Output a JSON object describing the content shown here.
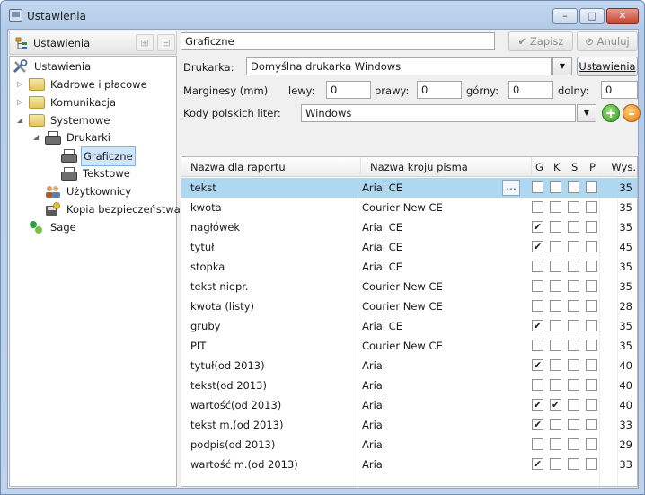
{
  "window": {
    "title": "Ustawienia",
    "minimize": "–",
    "maximize": "□",
    "close": "✕"
  },
  "left_toolbar": {
    "label": "Ustawienia"
  },
  "tree": {
    "root": "Ustawienia",
    "kadrowe": "Kadrowe i płacowe",
    "komunikacja": "Komunikacja",
    "systemowe": "Systemowe",
    "drukarki": "Drukarki",
    "graficzne": "Graficzne",
    "tekstowe": "Tekstowe",
    "uzytkownicy": "Użytkownicy",
    "kopia": "Kopia bezpieczeństwa",
    "sage": "Sage"
  },
  "form": {
    "name_value": "Graficzne",
    "save_label": "Zapisz",
    "cancel_label": "Anuluj",
    "printer_label": "Drukarka:",
    "printer_value": "Domyślna drukarka Windows",
    "printer_settings_label": "Ustawienia",
    "margins_label": "Marginesy (mm)",
    "left_label": "lewy:",
    "left_value": "0",
    "right_label": "prawy:",
    "right_value": "0",
    "top_label": "górny:",
    "top_value": "0",
    "bottom_label": "dolny:",
    "bottom_value": "0",
    "codes_label": "Kody polskich liter:",
    "codes_value": "Windows",
    "add_symbol": "+",
    "remove_symbol": "–"
  },
  "grid": {
    "headers": {
      "name": "Nazwa dla raportu",
      "font": "Nazwa kroju pisma",
      "g": "G",
      "k": "K",
      "s": "S",
      "p": "P",
      "height": "Wys."
    },
    "ellipsis": "...",
    "rows": [
      {
        "name": "tekst",
        "font": "Arial CE",
        "g": false,
        "k": false,
        "s": false,
        "p": false,
        "height": "35"
      },
      {
        "name": "kwota",
        "font": "Courier New CE",
        "g": false,
        "k": false,
        "s": false,
        "p": false,
        "height": "35"
      },
      {
        "name": "nagłówek",
        "font": "Arial CE",
        "g": true,
        "k": false,
        "s": false,
        "p": false,
        "height": "35"
      },
      {
        "name": "tytuł",
        "font": "Arial CE",
        "g": true,
        "k": false,
        "s": false,
        "p": false,
        "height": "45"
      },
      {
        "name": "stopka",
        "font": "Arial CE",
        "g": false,
        "k": false,
        "s": false,
        "p": false,
        "height": "35"
      },
      {
        "name": "tekst niepr.",
        "font": "Courier New CE",
        "g": false,
        "k": false,
        "s": false,
        "p": false,
        "height": "35"
      },
      {
        "name": "kwota (listy)",
        "font": "Courier New CE",
        "g": false,
        "k": false,
        "s": false,
        "p": false,
        "height": "28"
      },
      {
        "name": "gruby",
        "font": "Arial CE",
        "g": true,
        "k": false,
        "s": false,
        "p": false,
        "height": "35"
      },
      {
        "name": "PIT",
        "font": "Courier New CE",
        "g": false,
        "k": false,
        "s": false,
        "p": false,
        "height": "35"
      },
      {
        "name": "tytuł(od 2013)",
        "font": "Arial",
        "g": true,
        "k": false,
        "s": false,
        "p": false,
        "height": "40"
      },
      {
        "name": "tekst(od 2013)",
        "font": "Arial",
        "g": false,
        "k": false,
        "s": false,
        "p": false,
        "height": "40"
      },
      {
        "name": "wartość(od 2013)",
        "font": "Arial",
        "g": true,
        "k": true,
        "s": false,
        "p": false,
        "height": "40"
      },
      {
        "name": "tekst m.(od 2013)",
        "font": "Arial",
        "g": true,
        "k": false,
        "s": false,
        "p": false,
        "height": "33"
      },
      {
        "name": "podpis(od 2013)",
        "font": "Arial",
        "g": false,
        "k": false,
        "s": false,
        "p": false,
        "height": "29"
      },
      {
        "name": "wartość m.(od 2013)",
        "font": "Arial",
        "g": true,
        "k": false,
        "s": false,
        "p": false,
        "height": "33"
      }
    ]
  }
}
